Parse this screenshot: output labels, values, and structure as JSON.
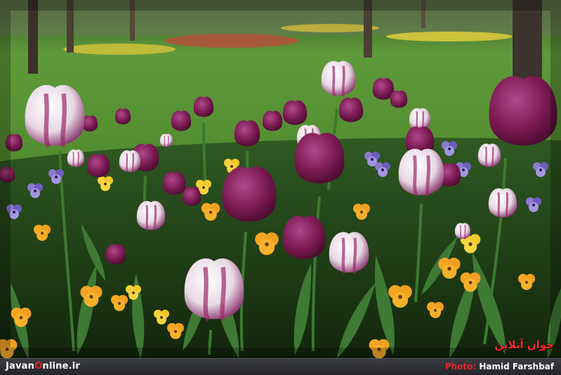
{
  "watermark": {
    "text": "جوان آنلاین"
  },
  "footer": {
    "site_prefix": "Javan",
    "site_o": "O",
    "site_suffix": "nline.ir",
    "photo_label": "Photo",
    "photographer": "Hamid Farshbaf"
  },
  "colors": {
    "accent_red": "#e3262c",
    "grass": "#5e9a3a",
    "tulip_purple": "#7b1a52",
    "pansy_orange": "#f0a020"
  }
}
